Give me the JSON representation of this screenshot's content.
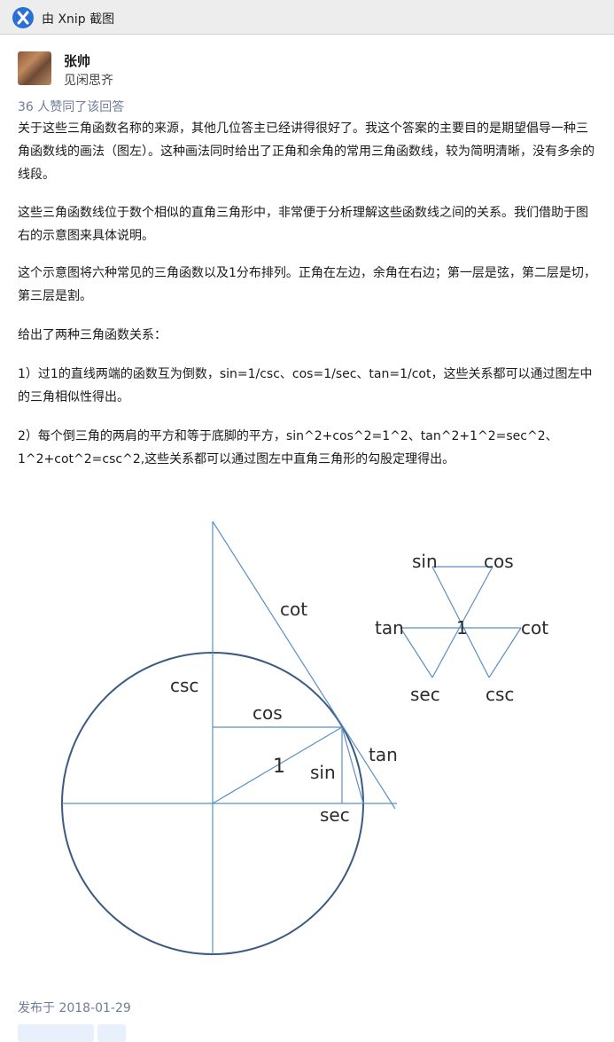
{
  "window": {
    "title": "由 Xnip 截图",
    "icon": "xnip-icon"
  },
  "author": {
    "name": "张帅",
    "bio": "见闲思齐",
    "avatar": "avatar-image"
  },
  "likes_text": "36 人赞同了该回答",
  "paragraphs": [
    "关于这些三角函数名称的来源，其他几位答主已经讲得很好了。我这个答案的主要目的是期望倡导一种三角函数线的画法（图左）。这种画法同时给出了正角和余角的常用三角函数线，较为简明清晰，没有多余的线段。",
    "这些三角函数线位于数个相似的直角三角形中，非常便于分析理解这些函数线之间的关系。我们借助于图右的示意图来具体说明。",
    "这个示意图将六种常见的三角函数以及1分布排列。正角在左边，余角在右边；第一层是弦，第二层是切，第三层是割。",
    "给出了两种三角函数关系：",
    "1）过1的直线两端的函数互为倒数，sin=1/csc、cos=1/sec、tan=1/cot，这些关系都可以通过图左中的三角相似性得出。",
    "2）每个倒三角的两肩的平方和等于底脚的平方，sin^2+cos^2=1^2、tan^2+1^2=sec^2、1^2+cot^2=csc^2,这些关系都可以通过图左中直角三角形的勾股定理得出。"
  ],
  "figure": {
    "circle_labels": {
      "csc": "csc",
      "cot": "cot",
      "cos": "cos",
      "one": "1",
      "sin": "sin",
      "tan": "tan",
      "sec": "sec"
    },
    "hexagon_labels": {
      "sin": "sin",
      "cos": "cos",
      "tan": "tan",
      "one": "1",
      "cot": "cot",
      "sec": "sec",
      "csc": "csc"
    },
    "line_color": "#5b8fc4",
    "circle_color": "#3b5a80"
  },
  "publish_text": "发布于 2018-01-29"
}
